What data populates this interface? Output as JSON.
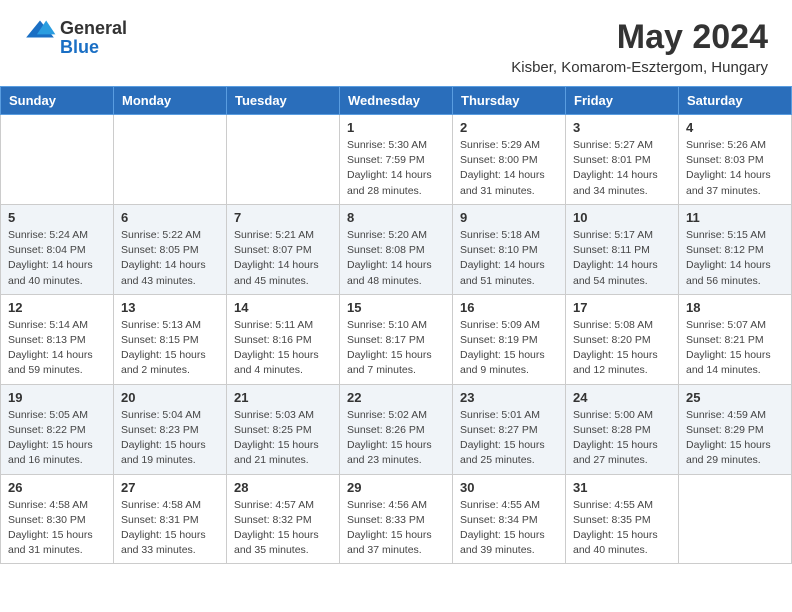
{
  "logo": {
    "general": "General",
    "blue": "Blue"
  },
  "title": {
    "month_year": "May 2024",
    "location": "Kisber, Komarom-Esztergom, Hungary"
  },
  "days_of_week": [
    "Sunday",
    "Monday",
    "Tuesday",
    "Wednesday",
    "Thursday",
    "Friday",
    "Saturday"
  ],
  "weeks": [
    [
      {
        "day": "",
        "sunrise": "",
        "sunset": "",
        "daylight": ""
      },
      {
        "day": "",
        "sunrise": "",
        "sunset": "",
        "daylight": ""
      },
      {
        "day": "",
        "sunrise": "",
        "sunset": "",
        "daylight": ""
      },
      {
        "day": "1",
        "sunrise": "Sunrise: 5:30 AM",
        "sunset": "Sunset: 7:59 PM",
        "daylight": "Daylight: 14 hours and 28 minutes."
      },
      {
        "day": "2",
        "sunrise": "Sunrise: 5:29 AM",
        "sunset": "Sunset: 8:00 PM",
        "daylight": "Daylight: 14 hours and 31 minutes."
      },
      {
        "day": "3",
        "sunrise": "Sunrise: 5:27 AM",
        "sunset": "Sunset: 8:01 PM",
        "daylight": "Daylight: 14 hours and 34 minutes."
      },
      {
        "day": "4",
        "sunrise": "Sunrise: 5:26 AM",
        "sunset": "Sunset: 8:03 PM",
        "daylight": "Daylight: 14 hours and 37 minutes."
      }
    ],
    [
      {
        "day": "5",
        "sunrise": "Sunrise: 5:24 AM",
        "sunset": "Sunset: 8:04 PM",
        "daylight": "Daylight: 14 hours and 40 minutes."
      },
      {
        "day": "6",
        "sunrise": "Sunrise: 5:22 AM",
        "sunset": "Sunset: 8:05 PM",
        "daylight": "Daylight: 14 hours and 43 minutes."
      },
      {
        "day": "7",
        "sunrise": "Sunrise: 5:21 AM",
        "sunset": "Sunset: 8:07 PM",
        "daylight": "Daylight: 14 hours and 45 minutes."
      },
      {
        "day": "8",
        "sunrise": "Sunrise: 5:20 AM",
        "sunset": "Sunset: 8:08 PM",
        "daylight": "Daylight: 14 hours and 48 minutes."
      },
      {
        "day": "9",
        "sunrise": "Sunrise: 5:18 AM",
        "sunset": "Sunset: 8:10 PM",
        "daylight": "Daylight: 14 hours and 51 minutes."
      },
      {
        "day": "10",
        "sunrise": "Sunrise: 5:17 AM",
        "sunset": "Sunset: 8:11 PM",
        "daylight": "Daylight: 14 hours and 54 minutes."
      },
      {
        "day": "11",
        "sunrise": "Sunrise: 5:15 AM",
        "sunset": "Sunset: 8:12 PM",
        "daylight": "Daylight: 14 hours and 56 minutes."
      }
    ],
    [
      {
        "day": "12",
        "sunrise": "Sunrise: 5:14 AM",
        "sunset": "Sunset: 8:13 PM",
        "daylight": "Daylight: 14 hours and 59 minutes."
      },
      {
        "day": "13",
        "sunrise": "Sunrise: 5:13 AM",
        "sunset": "Sunset: 8:15 PM",
        "daylight": "Daylight: 15 hours and 2 minutes."
      },
      {
        "day": "14",
        "sunrise": "Sunrise: 5:11 AM",
        "sunset": "Sunset: 8:16 PM",
        "daylight": "Daylight: 15 hours and 4 minutes."
      },
      {
        "day": "15",
        "sunrise": "Sunrise: 5:10 AM",
        "sunset": "Sunset: 8:17 PM",
        "daylight": "Daylight: 15 hours and 7 minutes."
      },
      {
        "day": "16",
        "sunrise": "Sunrise: 5:09 AM",
        "sunset": "Sunset: 8:19 PM",
        "daylight": "Daylight: 15 hours and 9 minutes."
      },
      {
        "day": "17",
        "sunrise": "Sunrise: 5:08 AM",
        "sunset": "Sunset: 8:20 PM",
        "daylight": "Daylight: 15 hours and 12 minutes."
      },
      {
        "day": "18",
        "sunrise": "Sunrise: 5:07 AM",
        "sunset": "Sunset: 8:21 PM",
        "daylight": "Daylight: 15 hours and 14 minutes."
      }
    ],
    [
      {
        "day": "19",
        "sunrise": "Sunrise: 5:05 AM",
        "sunset": "Sunset: 8:22 PM",
        "daylight": "Daylight: 15 hours and 16 minutes."
      },
      {
        "day": "20",
        "sunrise": "Sunrise: 5:04 AM",
        "sunset": "Sunset: 8:23 PM",
        "daylight": "Daylight: 15 hours and 19 minutes."
      },
      {
        "day": "21",
        "sunrise": "Sunrise: 5:03 AM",
        "sunset": "Sunset: 8:25 PM",
        "daylight": "Daylight: 15 hours and 21 minutes."
      },
      {
        "day": "22",
        "sunrise": "Sunrise: 5:02 AM",
        "sunset": "Sunset: 8:26 PM",
        "daylight": "Daylight: 15 hours and 23 minutes."
      },
      {
        "day": "23",
        "sunrise": "Sunrise: 5:01 AM",
        "sunset": "Sunset: 8:27 PM",
        "daylight": "Daylight: 15 hours and 25 minutes."
      },
      {
        "day": "24",
        "sunrise": "Sunrise: 5:00 AM",
        "sunset": "Sunset: 8:28 PM",
        "daylight": "Daylight: 15 hours and 27 minutes."
      },
      {
        "day": "25",
        "sunrise": "Sunrise: 4:59 AM",
        "sunset": "Sunset: 8:29 PM",
        "daylight": "Daylight: 15 hours and 29 minutes."
      }
    ],
    [
      {
        "day": "26",
        "sunrise": "Sunrise: 4:58 AM",
        "sunset": "Sunset: 8:30 PM",
        "daylight": "Daylight: 15 hours and 31 minutes."
      },
      {
        "day": "27",
        "sunrise": "Sunrise: 4:58 AM",
        "sunset": "Sunset: 8:31 PM",
        "daylight": "Daylight: 15 hours and 33 minutes."
      },
      {
        "day": "28",
        "sunrise": "Sunrise: 4:57 AM",
        "sunset": "Sunset: 8:32 PM",
        "daylight": "Daylight: 15 hours and 35 minutes."
      },
      {
        "day": "29",
        "sunrise": "Sunrise: 4:56 AM",
        "sunset": "Sunset: 8:33 PM",
        "daylight": "Daylight: 15 hours and 37 minutes."
      },
      {
        "day": "30",
        "sunrise": "Sunrise: 4:55 AM",
        "sunset": "Sunset: 8:34 PM",
        "daylight": "Daylight: 15 hours and 39 minutes."
      },
      {
        "day": "31",
        "sunrise": "Sunrise: 4:55 AM",
        "sunset": "Sunset: 8:35 PM",
        "daylight": "Daylight: 15 hours and 40 minutes."
      },
      {
        "day": "",
        "sunrise": "",
        "sunset": "",
        "daylight": ""
      }
    ]
  ]
}
